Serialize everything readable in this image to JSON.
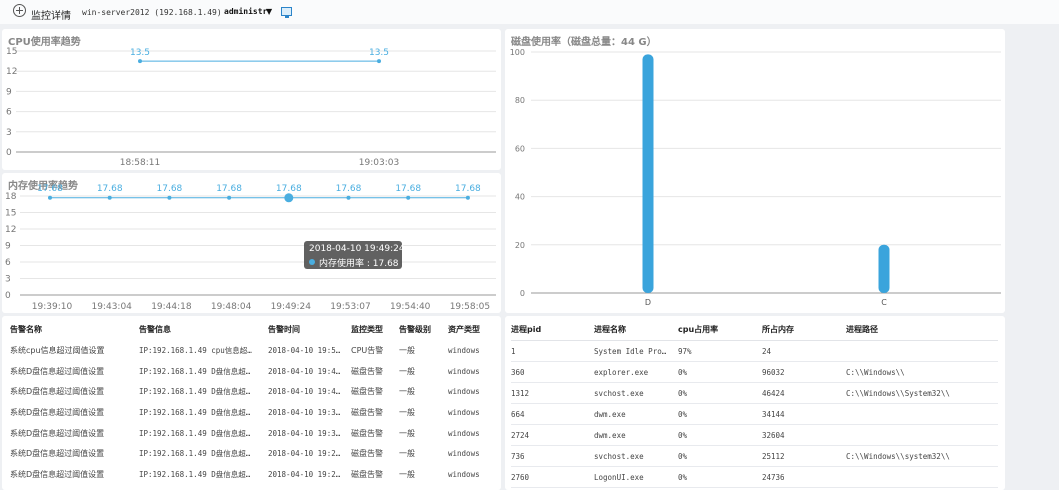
{
  "header": {
    "title": "监控详情",
    "server": "win-server2012 (192.168.1.49)",
    "user": "administr",
    "caret": "▼"
  },
  "cpu_chart": {
    "title": "CPU使用率趋势",
    "y_ticks": [
      "15",
      "12",
      "9",
      "6",
      "3",
      "0"
    ],
    "x_labels": [
      "18:58:11",
      "19:03:03"
    ],
    "points": [
      {
        "x": "18:58:11",
        "y": 13.5,
        "label": "13.5"
      },
      {
        "x": "19:03:03",
        "y": 13.5,
        "label": "13.5"
      }
    ],
    "ylim": [
      0,
      15
    ],
    "color": "#4aaee0"
  },
  "mem_chart": {
    "title": "内存使用率趋势",
    "y_ticks": [
      "18",
      "15",
      "12",
      "9",
      "6",
      "3",
      "0"
    ],
    "x_labels": [
      "19:39:10",
      "19:43:04",
      "19:44:18",
      "19:48:04",
      "19:49:24",
      "19:53:07",
      "19:54:40",
      "19:58:05"
    ],
    "values": [
      17.68,
      17.68,
      17.68,
      17.68,
      17.68,
      17.68,
      17.68,
      17.68
    ],
    "value_labels": [
      "17.68",
      "17.68",
      "17.68",
      "17.68",
      "17.68",
      "17.68",
      "17.68",
      "17.68"
    ],
    "ylim": [
      0,
      18
    ],
    "highlight_index": 4,
    "tooltip_time": "2018-04-10 19:49:24",
    "tooltip_label": "内存使用率 : 17.68",
    "color": "#4aaee0"
  },
  "disk_chart": {
    "title": "磁盘使用率（磁盘总量：44 G）",
    "y_ticks": [
      "100",
      "80",
      "60",
      "40",
      "20",
      "0"
    ],
    "categories": [
      "D",
      "C"
    ],
    "values": [
      99,
      20
    ],
    "ylim": [
      0,
      100
    ],
    "color": "#3aa4dc"
  },
  "alarm_table": {
    "headers": [
      "告警名称",
      "告警信息",
      "告警时间",
      "监控类型",
      "告警级别",
      "资产类型"
    ],
    "rows": [
      [
        "系统cpu信息超过阈值设置",
        "IP:192.168.1.49 cpu信息超…",
        "2018-04-10 19:5…",
        "CPU告警",
        "一般",
        "windows"
      ],
      [
        "系统D盘信息超过阈值设置",
        "IP:192.168.1.49 D盘信息超…",
        "2018-04-10 19:4…",
        "磁盘告警",
        "一般",
        "windows"
      ],
      [
        "系统D盘信息超过阈值设置",
        "IP:192.168.1.49 D盘信息超…",
        "2018-04-10 19:4…",
        "磁盘告警",
        "一般",
        "windows"
      ],
      [
        "系统D盘信息超过阈值设置",
        "IP:192.168.1.49 D盘信息超…",
        "2018-04-10 19:3…",
        "磁盘告警",
        "一般",
        "windows"
      ],
      [
        "系统D盘信息超过阈值设置",
        "IP:192.168.1.49 D盘信息超…",
        "2018-04-10 19:3…",
        "磁盘告警",
        "一般",
        "windows"
      ],
      [
        "系统D盘信息超过阈值设置",
        "IP:192.168.1.49 D盘信息超…",
        "2018-04-10 19:2…",
        "磁盘告警",
        "一般",
        "windows"
      ],
      [
        "系统D盘信息超过阈值设置",
        "IP:192.168.1.49 D盘信息超…",
        "2018-04-10 19:2…",
        "磁盘告警",
        "一般",
        "windows"
      ]
    ]
  },
  "process_table": {
    "headers": [
      "进程pid",
      "进程名称",
      "cpu占用率",
      "所占内存",
      "进程路径"
    ],
    "rows": [
      [
        "1",
        "System Idle Pro…",
        "97%",
        "24",
        ""
      ],
      [
        "360",
        "explorer.exe",
        "0%",
        "96032",
        "C:\\\\Windows\\\\"
      ],
      [
        "1312",
        "svchost.exe",
        "0%",
        "46424",
        "C:\\\\Windows\\\\System32\\\\"
      ],
      [
        "664",
        "dwm.exe",
        "0%",
        "34144",
        ""
      ],
      [
        "2724",
        "dwm.exe",
        "0%",
        "32604",
        ""
      ],
      [
        "736",
        "svchost.exe",
        "0%",
        "25112",
        "C:\\\\Windows\\\\system32\\\\"
      ],
      [
        "2760",
        "LogonUI.exe",
        "0%",
        "24736",
        ""
      ]
    ]
  }
}
